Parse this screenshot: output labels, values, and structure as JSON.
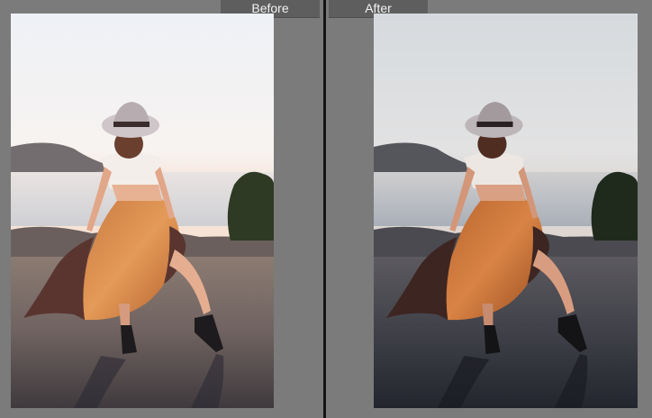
{
  "view": {
    "before_label": "Before",
    "after_label": "After"
  },
  "colors": {
    "app_bg": "#7b7b7b",
    "label_bg": "#5e5e5e",
    "divider": "#141414"
  },
  "photos": {
    "subject": "woman-in-hat-and-orange-skirt",
    "before_grade": "warm-bright",
    "after_grade": "cool-desaturated"
  }
}
